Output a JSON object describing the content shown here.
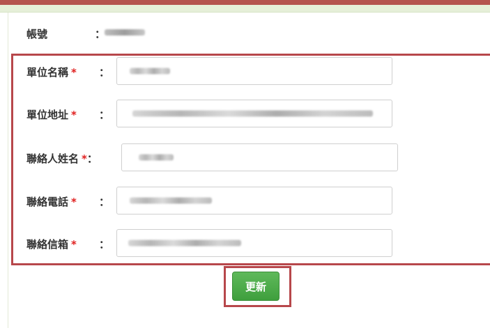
{
  "account": {
    "label": "帳號",
    "colon": "："
  },
  "fields": [
    {
      "label": "單位名稱",
      "required": "*",
      "colon": "："
    },
    {
      "label": "單位地址",
      "required": "*",
      "colon": "："
    },
    {
      "label": "聯絡人姓名",
      "required": "*",
      "colon": "："
    },
    {
      "label": "聯絡電話",
      "required": "*",
      "colon": "："
    },
    {
      "label": "聯絡信箱",
      "required": "*",
      "colon": "："
    }
  ],
  "actions": {
    "update_label": "更新"
  },
  "colors": {
    "top_bar": "#b5534f",
    "header_band": "#e6efd9",
    "highlight_border": "#b7474b",
    "required": "#e0201f",
    "button_green": "#4caf50"
  }
}
